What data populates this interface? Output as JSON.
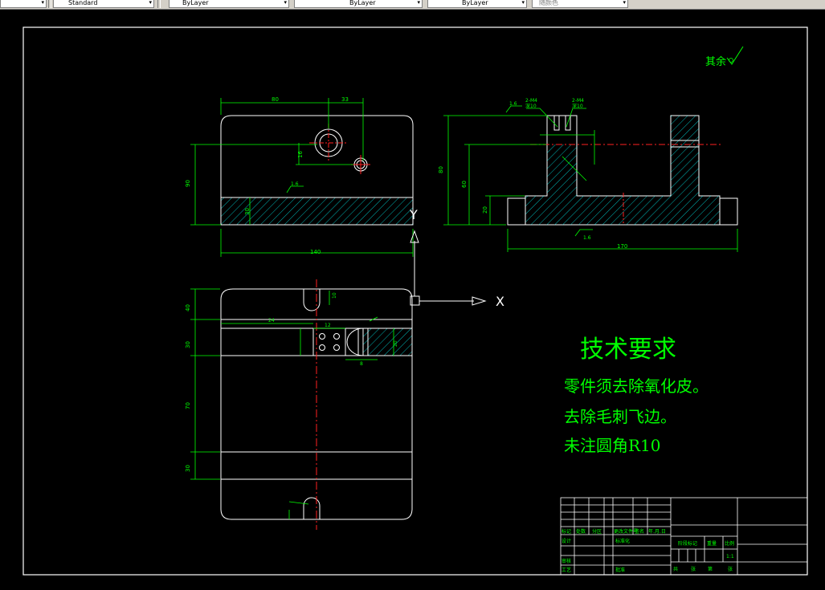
{
  "toolbar": {
    "text_style": "Standard",
    "layer": "ByLayer",
    "linetype": "ByLayer",
    "lineweight": "ByLayer",
    "plot_style": "随颜色"
  },
  "drawing": {
    "roughness_note": "其余",
    "tech_title": "技术要求",
    "tech_lines": [
      "零件须去除氧化皮。",
      "去除毛刺飞边。",
      "未注圆角R10"
    ],
    "axis_x": "X",
    "axis_y": "Y",
    "dims": {
      "top_width": "80",
      "top_offset": "33",
      "front_height": "90",
      "hole_offset": "16",
      "base_thickness": "30",
      "front_width": "140",
      "side_height": "80",
      "side_inner": "60",
      "side_base": "20",
      "side_width": "170",
      "roughness": "1.6",
      "thread_a": "2-M4",
      "thread_b": "深10",
      "thread_c": "2-M4",
      "thread_d": "深10",
      "plan_1": "40",
      "plan_2": "30",
      "plan_3": "70",
      "plan_4": "30",
      "plan_top": "24",
      "plan_mid": "12",
      "plan_r": "20",
      "plan_hole": "10",
      "plan_slot": "8"
    },
    "title_block": {
      "marks": "标记",
      "count": "处数",
      "zone": "分区",
      "change_doc": "更改文件号",
      "sign": "签名",
      "date": "年.月.日",
      "design": "设计",
      "standard": "标准化",
      "review": "审核",
      "process": "工艺",
      "approve": "批准",
      "stage": "阶段标记",
      "weight": "重量",
      "scale": "比例",
      "scale_val": "1:1",
      "sheet_total": "共",
      "sheet_label": "张",
      "sheet_no": "第",
      "sheet_label2": "张"
    }
  }
}
